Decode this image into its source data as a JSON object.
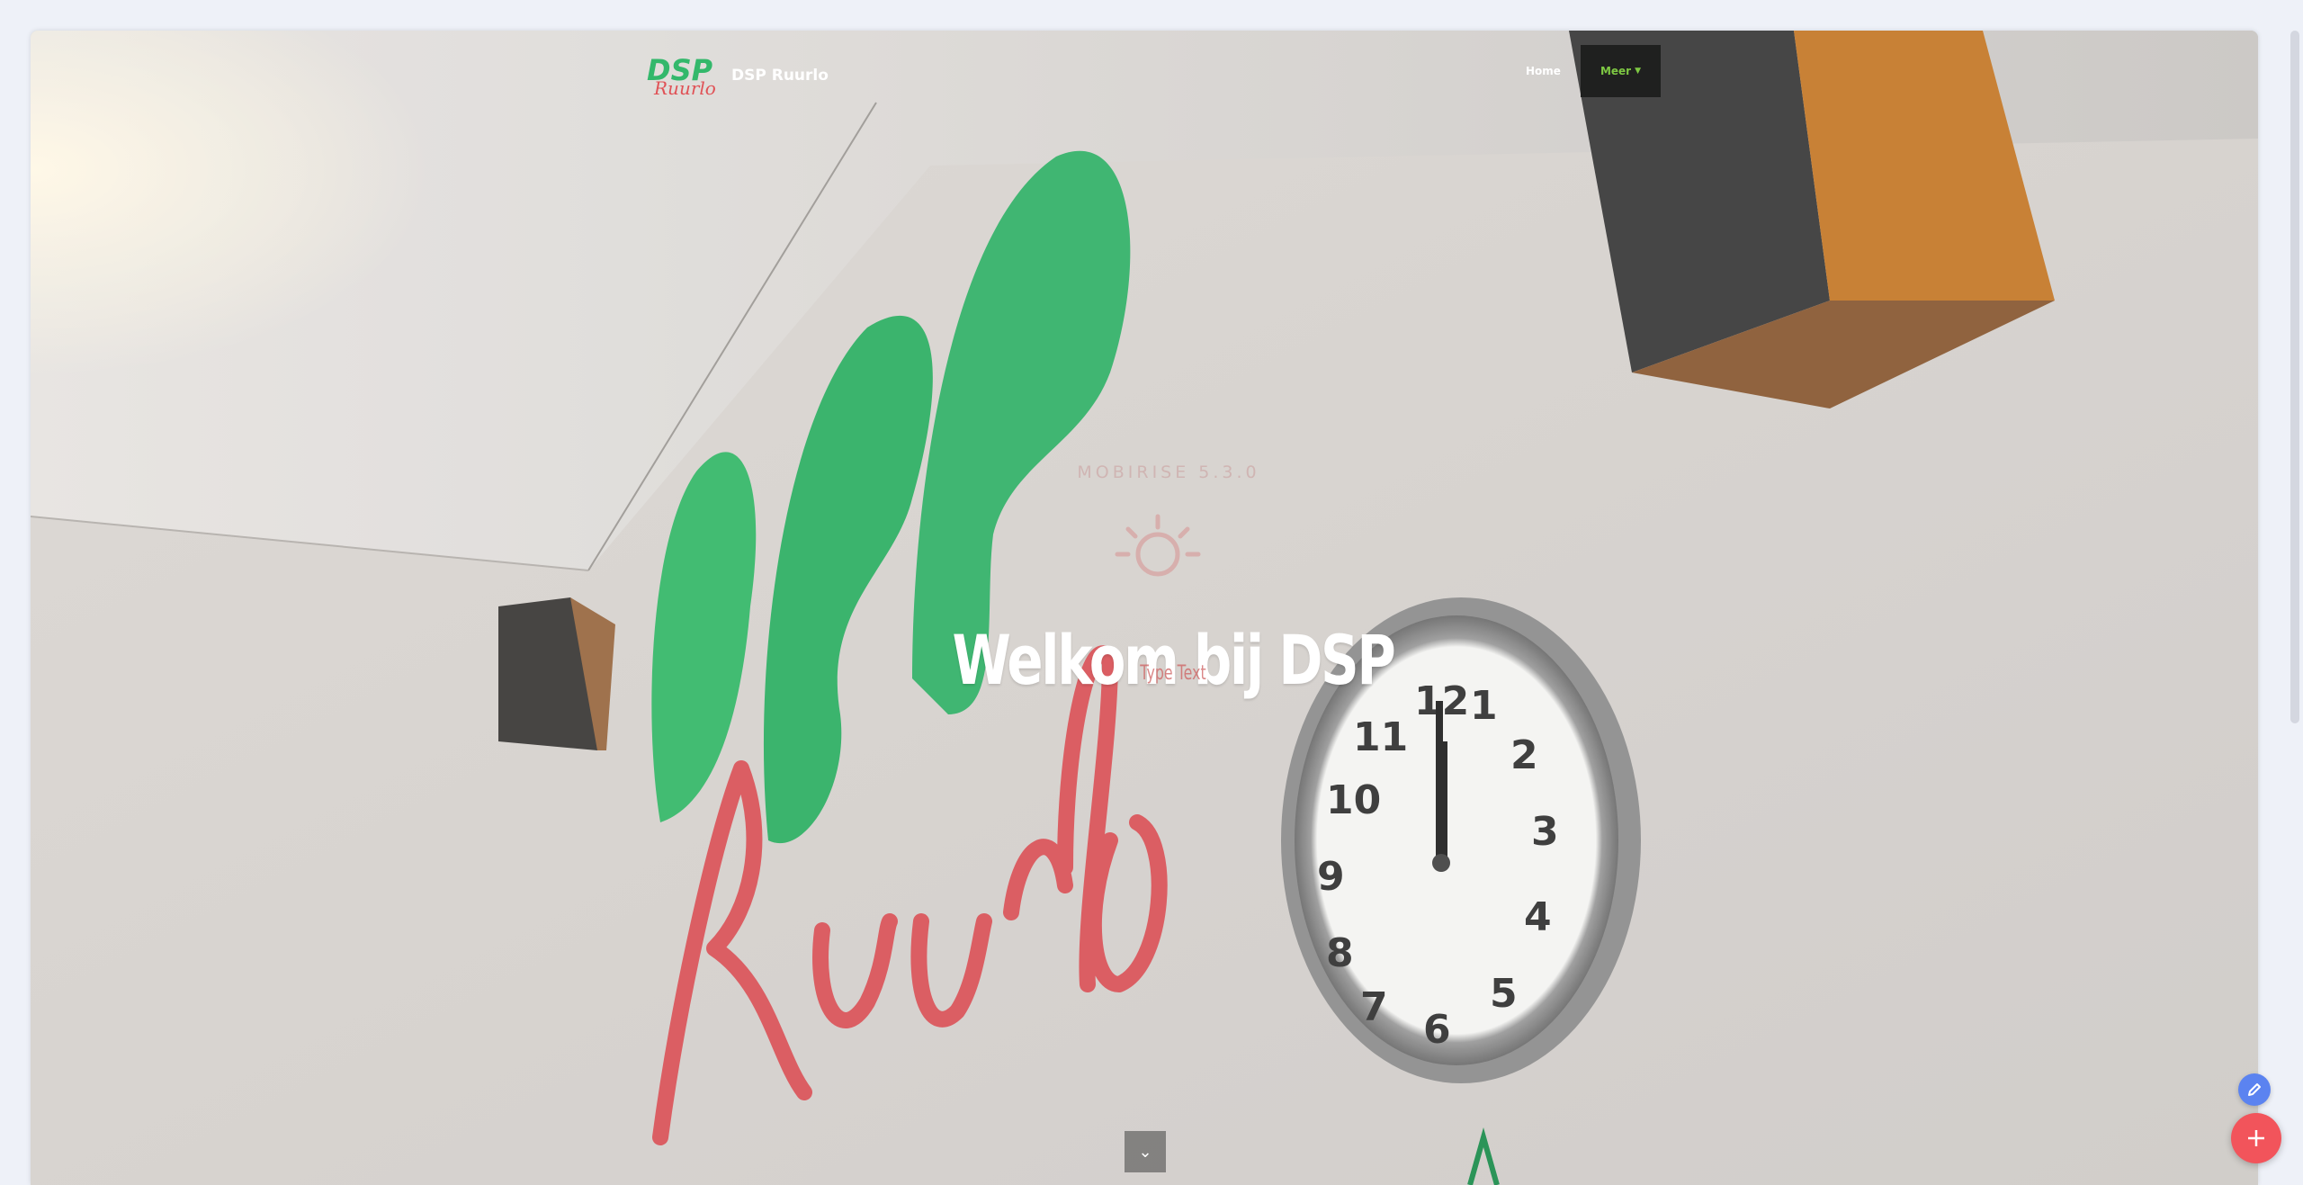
{
  "navbar": {
    "brand_name": "DSP Ruurlo",
    "links": [
      {
        "label": "Home"
      },
      {
        "label": "Meer"
      }
    ]
  },
  "hero": {
    "ghost_text": "MOBIRISE 5.3.0",
    "title": "Welkom bij DSP",
    "subtitle": "Type Text"
  },
  "icons": {
    "scroll": "chevron-down-icon",
    "edit": "pencil-icon",
    "add": "plus-icon"
  },
  "colors": {
    "accent_green": "#7ec843",
    "fab_red": "#f2545b",
    "fab_blue": "#5b83f0"
  }
}
